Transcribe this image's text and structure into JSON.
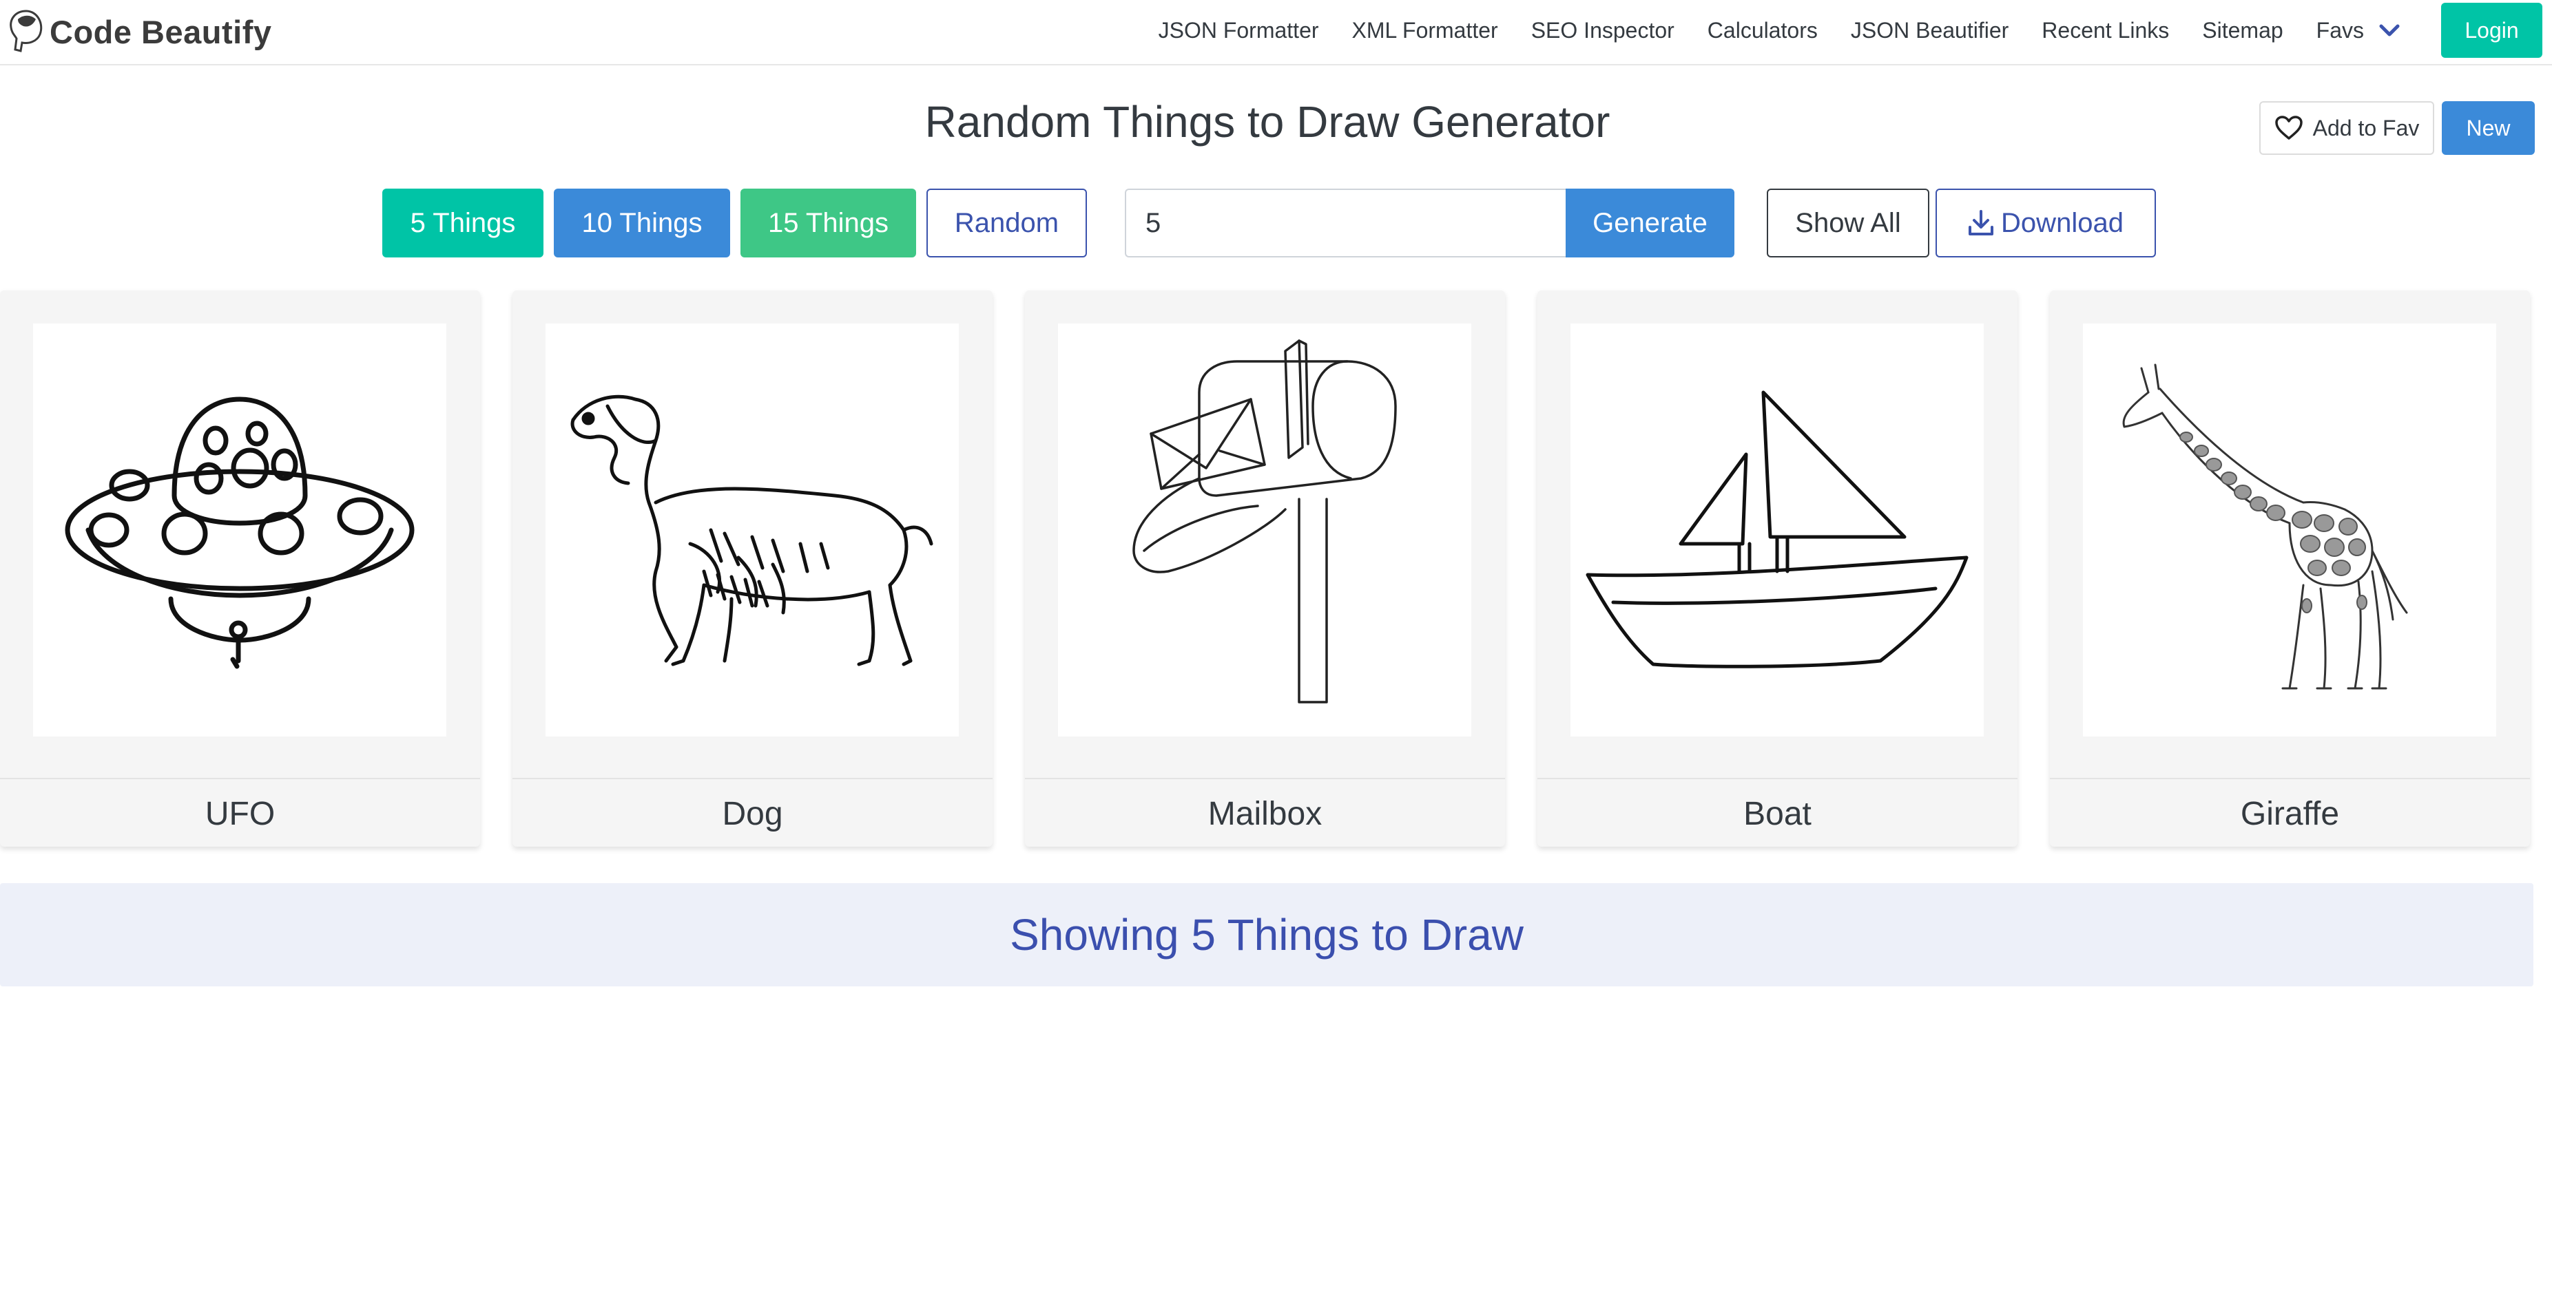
{
  "header": {
    "brand": "Code Beautify",
    "nav": [
      "JSON Formatter",
      "XML Formatter",
      "SEO Inspector",
      "Calculators",
      "JSON Beautifier",
      "Recent Links",
      "Sitemap"
    ],
    "favs_label": "Favs",
    "login_label": "Login"
  },
  "page": {
    "title": "Random Things to Draw Generator",
    "add_fav_label": "Add to Fav",
    "new_label": "New"
  },
  "controls": {
    "btn_5": "5 Things",
    "btn_10": "10 Things",
    "btn_15": "15 Things",
    "btn_random": "Random",
    "count_value": "5",
    "generate_label": "Generate",
    "show_all_label": "Show All",
    "download_label": "Download"
  },
  "cards": [
    {
      "label": "UFO",
      "icon": "ufo-drawing"
    },
    {
      "label": "Dog",
      "icon": "dog-drawing"
    },
    {
      "label": "Mailbox",
      "icon": "mailbox-drawing"
    },
    {
      "label": "Boat",
      "icon": "boat-drawing"
    },
    {
      "label": "Giraffe",
      "icon": "giraffe-drawing"
    }
  ],
  "banner": "Showing 5 Things to Draw",
  "colors": {
    "teal": "#00c4a6",
    "blue": "#3b8ad9",
    "green": "#3ec786",
    "indigo": "#3b53ad"
  }
}
